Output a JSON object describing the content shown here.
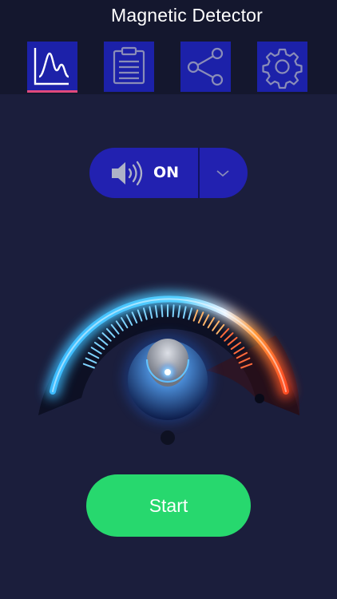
{
  "header": {
    "title": "Magnetic Detector",
    "tabs": [
      {
        "name": "graph",
        "icon": "line-chart-icon",
        "selected": true
      },
      {
        "name": "log",
        "icon": "clipboard-icon",
        "selected": false
      },
      {
        "name": "share",
        "icon": "share-icon",
        "selected": false
      },
      {
        "name": "settings",
        "icon": "gear-icon",
        "selected": false
      }
    ]
  },
  "sound": {
    "icon": "speaker-icon",
    "label": "ON"
  },
  "meter": {
    "level": 0
  },
  "start": {
    "label": "Start"
  },
  "colors": {
    "background": "#1b1e3c",
    "header": "#14172e",
    "tab": "#1c21a9",
    "tab_underline": "#e0497c",
    "pill": "#2221b0",
    "start_button": "#27d86e"
  }
}
